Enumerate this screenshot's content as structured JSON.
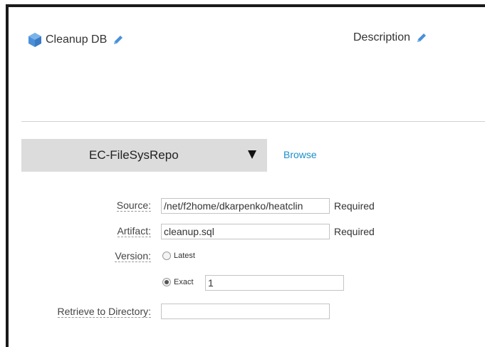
{
  "header": {
    "title": "Cleanup DB",
    "description_label": "Description"
  },
  "repository": {
    "selected": "EC-FileSysRepo",
    "browse_label": "Browse"
  },
  "form": {
    "source": {
      "label": "Source:",
      "value": "/net/f2home/dkarpenko/heatclin",
      "required": "Required"
    },
    "artifact": {
      "label": "Artifact:",
      "value": "cleanup.sql",
      "required": "Required"
    },
    "version": {
      "label": "Version:",
      "options": [
        {
          "label": "Latest",
          "checked": false
        },
        {
          "label": "Exact",
          "checked": true
        }
      ],
      "exact_value": "1"
    },
    "retrieve": {
      "label": "Retrieve to Directory:",
      "value": ""
    }
  },
  "colors": {
    "accent": "#1a8fc9",
    "icon_blue": "#4a90d9",
    "select_bg": "#dcdcdc"
  }
}
